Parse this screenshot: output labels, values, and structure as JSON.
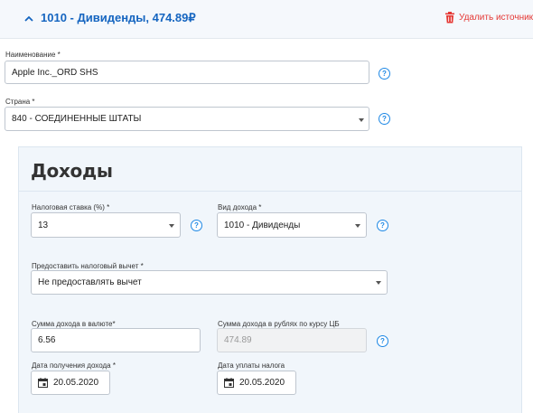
{
  "header": {
    "title": "1010 - Дивиденды, 474.89₽",
    "delete_label": "Удалить источник"
  },
  "name_field": {
    "label": "Наименование *",
    "value": "Apple Inc._ORD SHS"
  },
  "country_field": {
    "label": "Страна *",
    "value": "840 - СОЕДИНЕННЫЕ ШТАТЫ"
  },
  "income": {
    "title": "Доходы",
    "tax_rate": {
      "label": "Налоговая ставка (%) *",
      "value": "13"
    },
    "income_type": {
      "label": "Вид дохода *",
      "value": "1010 - Дивиденды"
    },
    "deduction": {
      "label": "Предоставить налоговый вычет *",
      "value": "Не предоставлять вычет"
    },
    "amount_currency": {
      "label": "Сумма дохода в валюте*",
      "value": "6.56"
    },
    "amount_rub": {
      "label": "Сумма дохода в рублях по курсу ЦБ",
      "value": "474.89"
    },
    "income_date": {
      "label": "Дата получения дохода *",
      "value": "20.05.2020"
    },
    "tax_payment_date": {
      "label": "Дата уплаты налога",
      "value": "20.05.2020"
    }
  },
  "help_icon_text": "?",
  "colors": {
    "accent": "#1565c0",
    "danger": "#e53935",
    "help": "#1e88e5",
    "panel_bg": "#f1f6fb"
  }
}
